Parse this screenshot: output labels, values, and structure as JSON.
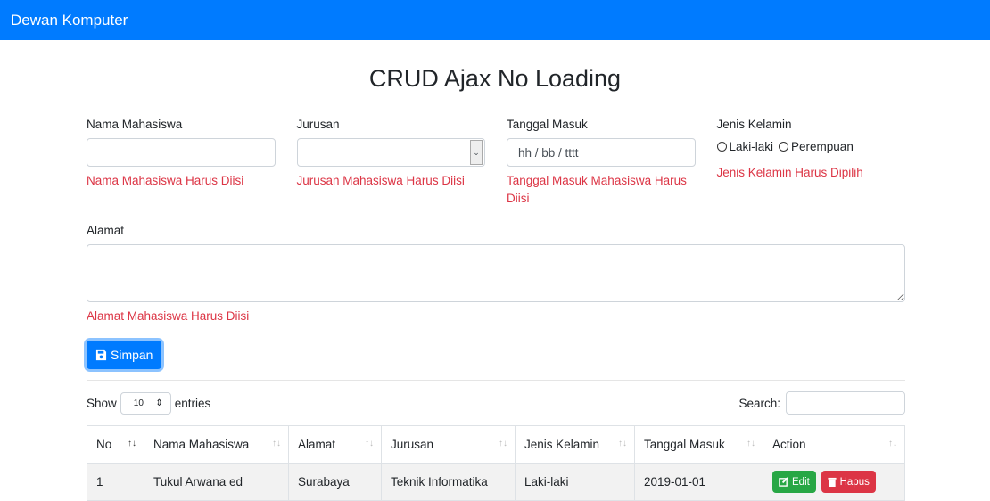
{
  "navbar": {
    "brand": "Dewan Komputer"
  },
  "page_title": "CRUD Ajax No Loading",
  "form": {
    "nama": {
      "label": "Nama Mahasiswa",
      "value": "",
      "error": "Nama Mahasiswa Harus Diisi"
    },
    "jurusan": {
      "label": "Jurusan",
      "value": "",
      "error": "Jurusan Mahasiswa Harus Diisi"
    },
    "tanggal": {
      "label": "Tanggal Masuk",
      "placeholder": "hh / bb / tttt",
      "error": "Tanggal Masuk Mahasiswa Harus Diisi"
    },
    "jk": {
      "label": "Jenis Kelamin",
      "options": [
        "Laki-laki",
        "Perempuan"
      ],
      "error": "Jenis Kelamin Harus Dipilih"
    },
    "alamat": {
      "label": "Alamat",
      "value": "",
      "error": "Alamat Mahasiswa Harus Diisi"
    },
    "save_label": "Simpan"
  },
  "table": {
    "show_label": "Show",
    "entries_value": "10",
    "entries_label": "entries",
    "search_label": "Search:",
    "columns": [
      "No",
      "Nama Mahasiswa",
      "Alamat",
      "Jurusan",
      "Jenis Kelamin",
      "Tanggal Masuk",
      "Action"
    ],
    "rows": [
      {
        "no": "1",
        "nama": "Tukul Arwana ed",
        "alamat": "Surabaya",
        "jurusan": "Teknik Informatika",
        "jk": "Laki-laki",
        "tanggal": "2019-01-01"
      }
    ],
    "edit_label": "Edit",
    "delete_label": "Hapus"
  },
  "colors": {
    "primary": "#007bff",
    "danger": "#dc3545",
    "success": "#28a745"
  }
}
